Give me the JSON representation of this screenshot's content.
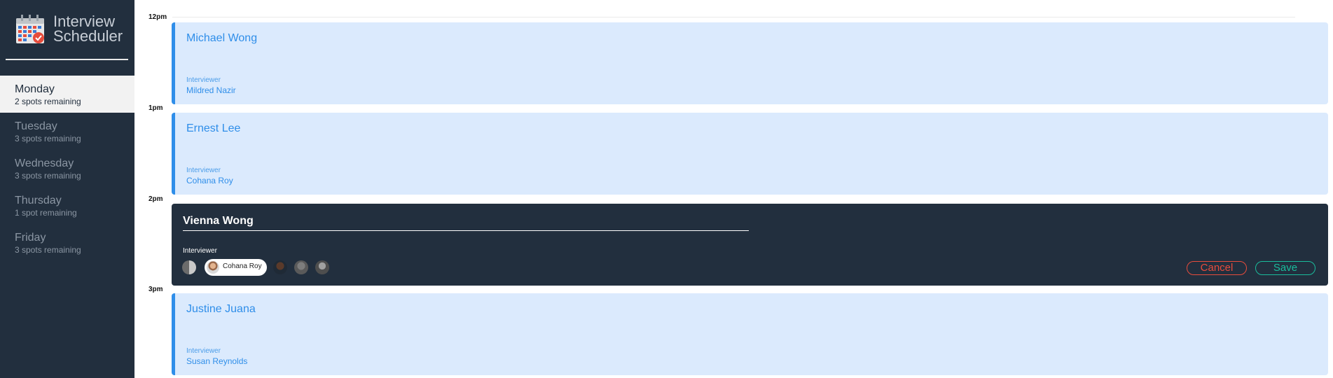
{
  "app": {
    "title_line1": "Interview",
    "title_line2": "Scheduler",
    "logo_icon": "calendar-check-icon",
    "colors": {
      "sidebar": "#222f3e",
      "accent_blue": "#2f8ee9",
      "card_bg": "#dbeafd",
      "cancel": "#e74c3c",
      "save": "#1abc9c"
    }
  },
  "sidebar": {
    "days": [
      {
        "name": "Monday",
        "spots": "2 spots remaining",
        "selected": true
      },
      {
        "name": "Tuesday",
        "spots": "3 spots remaining",
        "selected": false
      },
      {
        "name": "Wednesday",
        "spots": "3 spots remaining",
        "selected": false
      },
      {
        "name": "Thursday",
        "spots": "1 spot remaining",
        "selected": false
      },
      {
        "name": "Friday",
        "spots": "3 spots remaining",
        "selected": false
      }
    ]
  },
  "schedule": {
    "times": [
      "12pm",
      "1pm",
      "2pm",
      "3pm"
    ],
    "appointments": [
      {
        "student": "Michael Wong",
        "interviewer_label": "Interviewer",
        "interviewer": "Mildred Nazir"
      },
      {
        "student": "Ernest Lee",
        "interviewer_label": "Interviewer",
        "interviewer": "Cohana Roy"
      },
      {
        "student": "Justine Juana",
        "interviewer_label": "Interviewer",
        "interviewer": "Susan Reynolds"
      }
    ],
    "editing": {
      "student_value": "Vienna Wong",
      "interviewer_label": "Interviewer",
      "selected_interviewer": "Cohana Roy",
      "cancel_label": "Cancel",
      "save_label": "Save"
    }
  }
}
